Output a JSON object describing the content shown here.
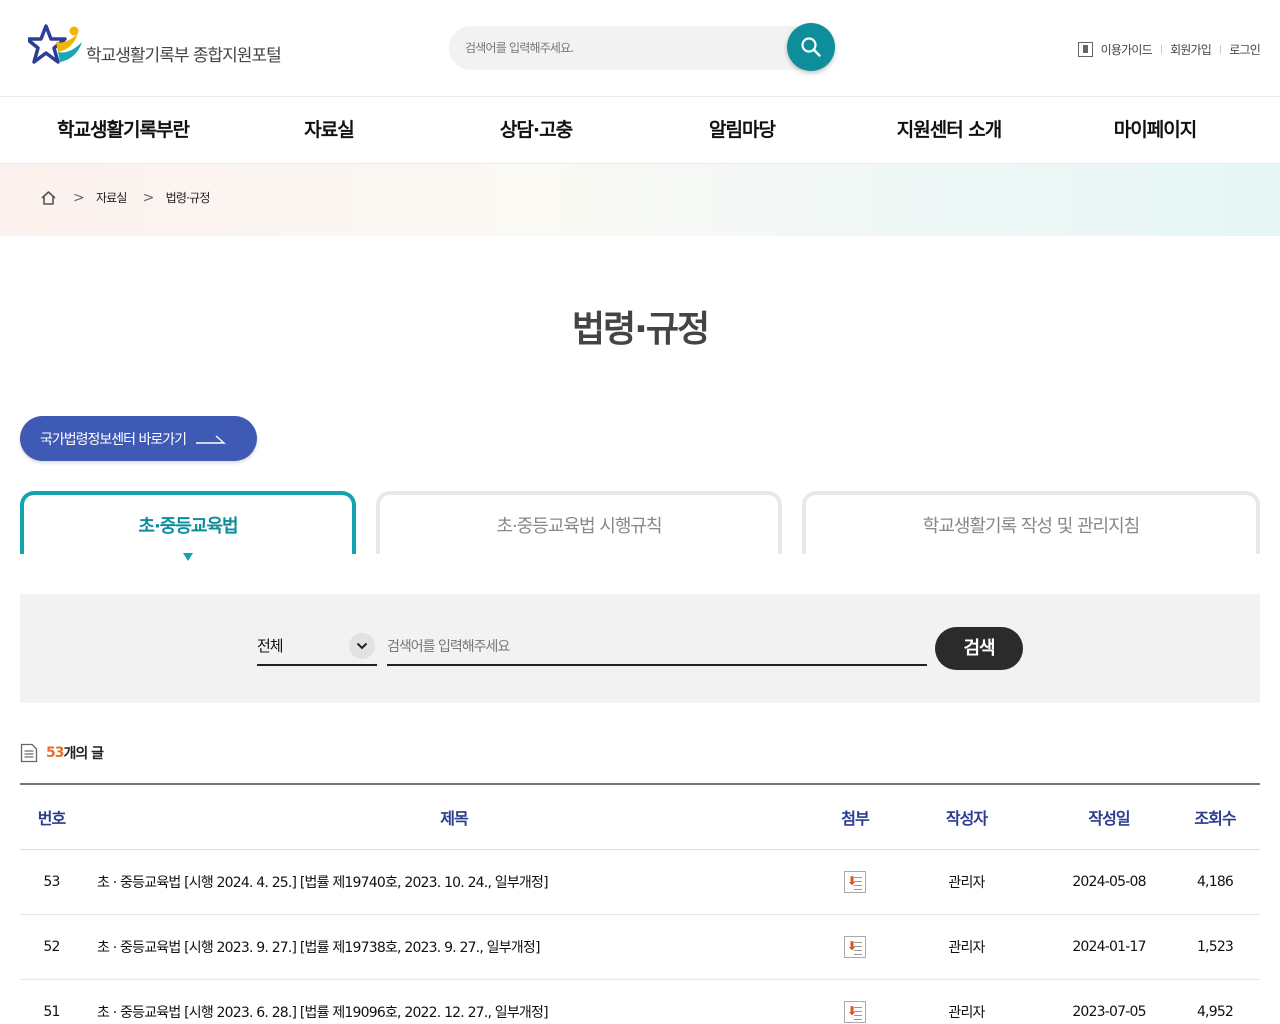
{
  "header": {
    "logo_text": "학교생활기록부 종합지원포털",
    "search_placeholder": "검색어를 입력해주세요.",
    "util_links": [
      "이용가이드",
      "회원가입",
      "로그인"
    ]
  },
  "gnb": [
    {
      "label": "학교생활기록부란"
    },
    {
      "label": "자료실"
    },
    {
      "label": "상담·고충"
    },
    {
      "label": "알림마당"
    },
    {
      "label": "지원센터 소개"
    },
    {
      "label": "마이페이지"
    }
  ],
  "breadcrumb": [
    "자료실",
    "법령·규정"
  ],
  "page_title": "법령·규정",
  "law_button": "국가법령정보센터 바로가기",
  "tabs": [
    {
      "label": "초·중등교육법",
      "active": true
    },
    {
      "label": "초·중등교육법 시행규칙",
      "active": false
    },
    {
      "label": "학교생활기록 작성 및 관리지침",
      "active": false
    }
  ],
  "search": {
    "select_value": "전체",
    "keyword_placeholder": "검색어를 입력해주세요",
    "button_label": "검색"
  },
  "count": {
    "number": "53",
    "unit": "개의 글"
  },
  "table": {
    "headers": [
      "번호",
      "제목",
      "첨부",
      "작성자",
      "작성일",
      "조회수"
    ],
    "rows": [
      {
        "no": "53",
        "title": "초 · 중등교육법 [시행 2024. 4. 25.] [법률 제19740호, 2023. 10. 24., 일부개정]",
        "author": "관리자",
        "date": "2024-05-08",
        "views": "4,186"
      },
      {
        "no": "52",
        "title": "초 · 중등교육법 [시행 2023. 9. 27.] [법률 제19738호, 2023. 9. 27., 일부개정]",
        "author": "관리자",
        "date": "2024-01-17",
        "views": "1,523"
      },
      {
        "no": "51",
        "title": "초 · 중등교육법 [시행 2023. 6. 28.] [법률 제19096호, 2022. 12. 27., 일부개정]",
        "author": "관리자",
        "date": "2023-07-05",
        "views": "4,952"
      }
    ]
  },
  "colors": {
    "accent_teal": "#0e8e9a",
    "law_button_blue": "#3f5ab4",
    "count_orange": "#e0702c",
    "header_navy": "#2a3d8f"
  }
}
